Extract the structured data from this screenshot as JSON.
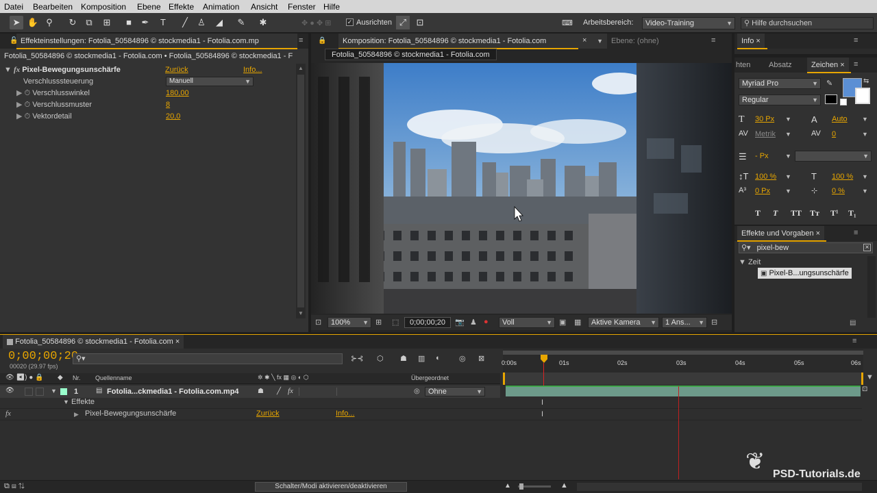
{
  "menu": [
    "Datei",
    "Bearbeiten",
    "Komposition",
    "Ebene",
    "Effekte",
    "Animation",
    "Ansicht",
    "Fenster",
    "Hilfe"
  ],
  "toolbar": {
    "snap_label": "Ausrichten",
    "workspace_label": "Arbeitsbereich:",
    "workspace_value": "Video-Training",
    "help_placeholder": "Hilfe durchsuchen"
  },
  "effect_panel": {
    "tab": "Effekteinstellungen: Fotolia_50584896 © stockmedia1 - Fotolia.com.mp",
    "breadcrumb": "Fotolia_50584896 © stockmedia1 - Fotolia.com • Fotolia_50584896 © stockmedia1 - F",
    "effect_name": "Pixel-Bewegungsunschärfe",
    "reset": "Zurück",
    "info": "Info...",
    "rows": [
      {
        "label": "Verschlusssteuerung",
        "value": "Manuell"
      },
      {
        "label": "Verschlusswinkel",
        "value": "180,00"
      },
      {
        "label": "Verschlussmuster",
        "value": "8"
      },
      {
        "label": "Vektordetail",
        "value": "20,0"
      }
    ]
  },
  "comp_panel": {
    "tab": "Komposition: Fotolia_50584896 © stockmedia1 - Fotolia.com",
    "layer_tab": "Ebene: (ohne)",
    "comp_chip": "Fotolia_50584896 © stockmedia1 - Fotolia.com",
    "zoom": "100%",
    "timecode": "0;00;00;20",
    "resolution": "Voll",
    "camera": "Aktive Kamera",
    "views": "1 Ans..."
  },
  "info_panel": {
    "tab": "Info"
  },
  "char_panel": {
    "tabs": [
      "hten",
      "Absatz",
      "Zeichen"
    ],
    "font": "Myriad Pro",
    "style": "Regular",
    "size": "30 Px",
    "leading": "Auto",
    "kerning": "Metrik",
    "tracking": "0",
    "stroke": "- Px",
    "vscale": "100 %",
    "hscale": "100 %",
    "baseline": "0 Px",
    "tsume": "0 %",
    "styles": [
      "T",
      "T",
      "TT",
      "Tт",
      "T¹",
      "T₁"
    ],
    "fill_color": "#5b8fd4"
  },
  "effects_presets": {
    "tab": "Effekte und Vorgaben",
    "search": "pixel-bew",
    "category": "Zeit",
    "item": "Pixel-B...ungsunschärfe"
  },
  "timeline": {
    "tab": "Fotolia_50584896 © stockmedia1 - Fotolia.com",
    "timecode": "0;00;00;20",
    "fps": "00020 (29.97 fps)",
    "col_nr": "Nr.",
    "col_source": "Quellenname",
    "col_parent": "Übergeordnet",
    "layer_num": "1",
    "layer_name": "Fotolia...ckmedia1 - Fotolia.com.mp4",
    "parent_value": "Ohne",
    "effects_label": "Effekte",
    "effect_name": "Pixel-Bewegungsunschärfe",
    "reset": "Zurück",
    "info": "Info...",
    "ruler": [
      "0:00s",
      "01s",
      "02s",
      "03s",
      "04s",
      "05s",
      "06s"
    ],
    "toggle_modes": "Schalter/Modi aktivieren/deaktivieren"
  },
  "watermark": "PSD-Tutorials.de"
}
